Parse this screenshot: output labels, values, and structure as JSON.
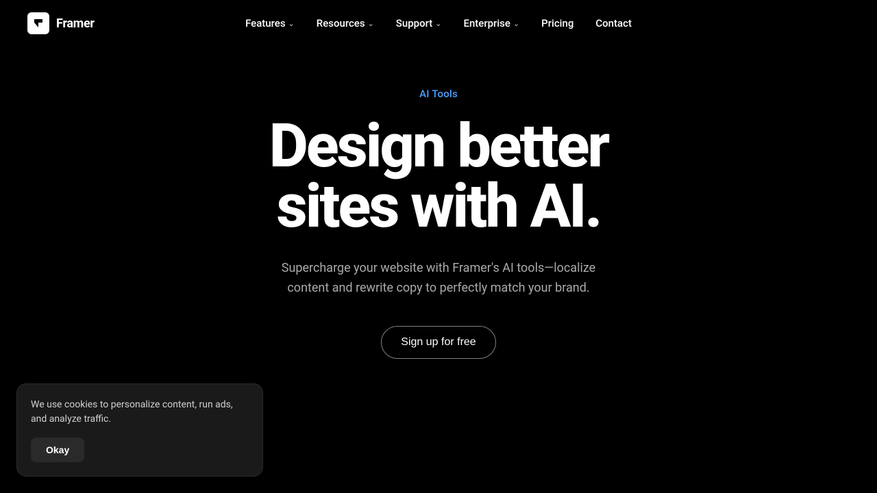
{
  "brand": {
    "name": "Framer",
    "logo_alt": "Framer logo"
  },
  "nav": {
    "links": [
      {
        "label": "Features",
        "has_dropdown": true
      },
      {
        "label": "Resources",
        "has_dropdown": true
      },
      {
        "label": "Support",
        "has_dropdown": true
      },
      {
        "label": "Enterprise",
        "has_dropdown": true
      },
      {
        "label": "Pricing",
        "has_dropdown": false
      },
      {
        "label": "Contact",
        "has_dropdown": false
      }
    ]
  },
  "hero": {
    "eyebrow": "AI Tools",
    "title_line1": "Design better",
    "title_line2": "sites with AI.",
    "subtitle": "Supercharge your website with Framer's AI tools—localize content and rewrite copy to perfectly match your brand.",
    "cta_label": "Sign up for free"
  },
  "cookie": {
    "message": "We use cookies to personalize content, run ads, and analyze traffic.",
    "button_label": "Okay"
  }
}
